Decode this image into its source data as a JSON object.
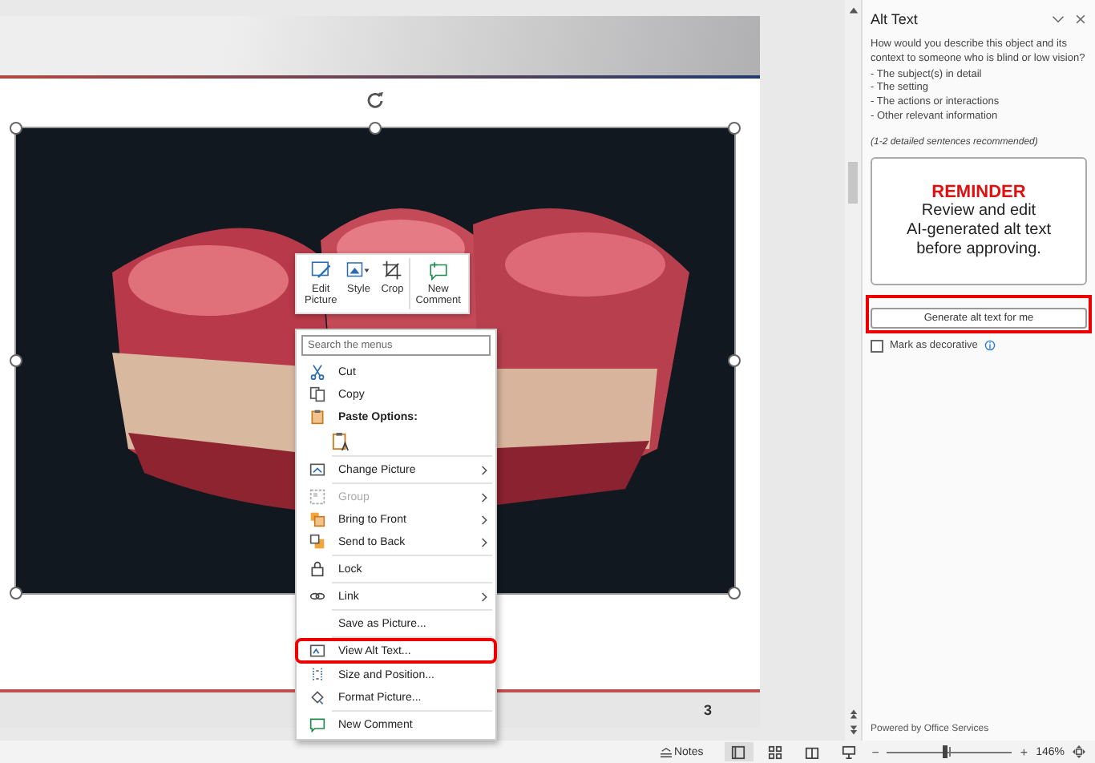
{
  "slide": {
    "number": "3",
    "picture": {
      "selected": true
    }
  },
  "mini_toolbar": [
    {
      "kind": "edit",
      "label": "Edit\nPicture"
    },
    {
      "kind": "style",
      "label": "Style"
    },
    {
      "kind": "crop",
      "label": "Crop"
    },
    {
      "kind": "comment",
      "label": "New\nComment"
    }
  ],
  "context_menu": {
    "search": {
      "placeholder": "Search the menus"
    },
    "items": [
      {
        "kind": "cut",
        "label": "Cut",
        "submenu": false,
        "disabled": false,
        "highlighted": false
      },
      {
        "kind": "copy",
        "label": "Copy",
        "submenu": false,
        "disabled": false,
        "highlighted": false
      },
      {
        "kind": "header",
        "label": "Paste Options:"
      },
      {
        "kind": "paste"
      },
      {
        "kind": "change",
        "label": "Change Picture",
        "submenu": true,
        "disabled": false,
        "highlighted": false
      },
      {
        "kind": "group",
        "label": "Group",
        "submenu": true,
        "disabled": true,
        "highlighted": false
      },
      {
        "kind": "front",
        "label": "Bring to Front",
        "submenu": true,
        "disabled": false,
        "highlighted": false
      },
      {
        "kind": "back",
        "label": "Send to Back",
        "submenu": true,
        "disabled": false,
        "highlighted": false
      },
      {
        "kind": "lock",
        "label": "Lock",
        "submenu": false,
        "disabled": false,
        "highlighted": false
      },
      {
        "kind": "link",
        "label": "Link",
        "submenu": true,
        "disabled": false,
        "highlighted": false
      },
      {
        "kind": "save",
        "label": "Save as Picture...",
        "submenu": false,
        "disabled": false,
        "highlighted": false
      },
      {
        "kind": "alt",
        "label": "View Alt Text...",
        "submenu": false,
        "disabled": false,
        "highlighted": true
      },
      {
        "kind": "size",
        "label": "Size and Position...",
        "submenu": false,
        "disabled": false,
        "highlighted": false
      },
      {
        "kind": "format",
        "label": "Format Picture...",
        "submenu": false,
        "disabled": false,
        "highlighted": false
      },
      {
        "kind": "comment",
        "label": "New Comment",
        "submenu": false,
        "disabled": false,
        "highlighted": false
      }
    ]
  },
  "alt_text_pane": {
    "title": "Alt Text",
    "question": "How would you describe this object and its context to someone who is blind or low vision?",
    "hints": [
      "- The subject(s) in detail",
      "- The setting",
      "- The actions or interactions",
      "- Other relevant information"
    ],
    "note": "(1-2 detailed sentences recommended)",
    "reminder": {
      "heading": "REMINDER",
      "lines": [
        "Review and edit",
        "AI-generated alt text",
        "before approving."
      ]
    },
    "generate_button": {
      "label": "Generate alt text for me",
      "highlighted": true
    },
    "decorative": {
      "label": "Mark as decorative",
      "checked": false
    },
    "footer": "Powered by Office Services"
  },
  "status_bar": {
    "notes": "Notes",
    "views": [
      {
        "kind": "normal",
        "selected": true
      },
      {
        "kind": "sorter",
        "selected": false
      },
      {
        "kind": "reading",
        "selected": false
      },
      {
        "kind": "show",
        "selected": false
      }
    ],
    "zoom": {
      "out": "−",
      "level": 0.45,
      "in": "+",
      "reading": "146%"
    }
  }
}
